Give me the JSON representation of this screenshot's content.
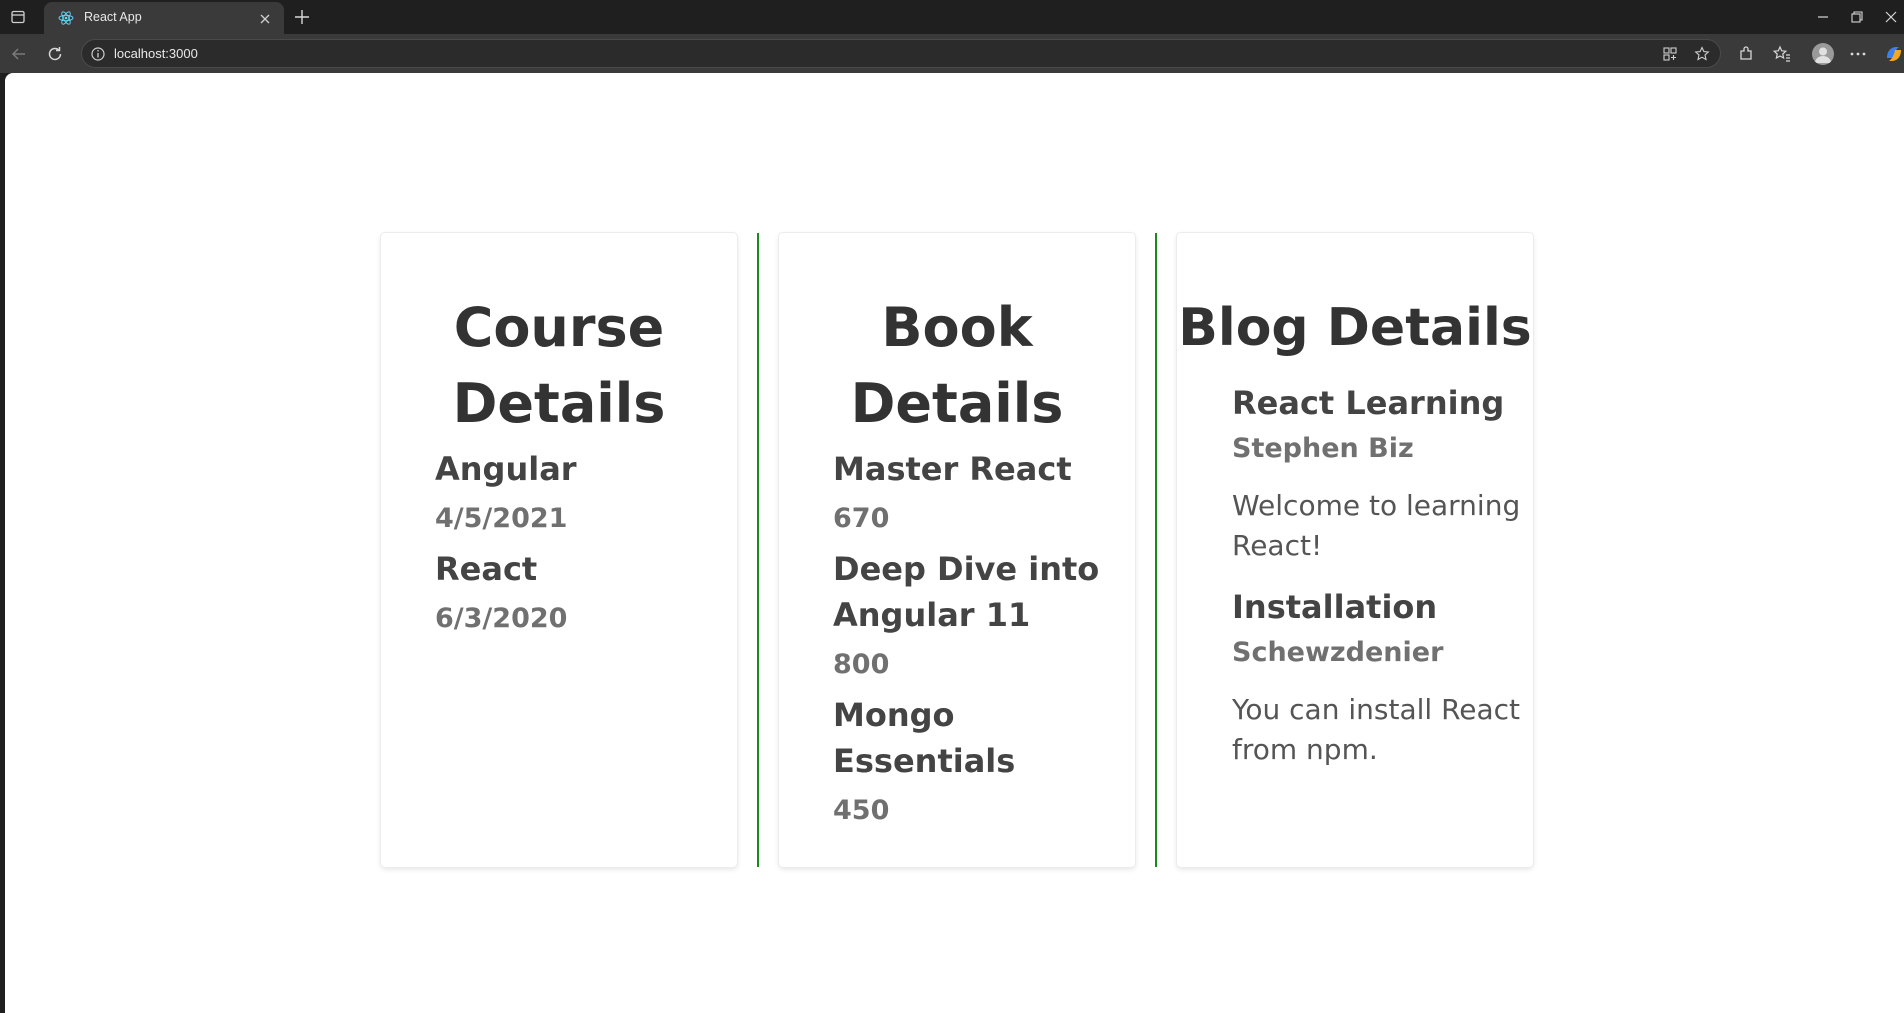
{
  "browser": {
    "tab_title": "React App",
    "url": "localhost:3000"
  },
  "course": {
    "title": "Course Details",
    "items": [
      {
        "name": "Angular",
        "date": "4/5/2021"
      },
      {
        "name": "React",
        "date": "6/3/2020"
      }
    ]
  },
  "book": {
    "title": "Book Details",
    "items": [
      {
        "name": "Master React",
        "price": "670"
      },
      {
        "name": "Deep Dive into Angular 11",
        "price": "800"
      },
      {
        "name": "Mongo Essentials",
        "price": "450"
      }
    ]
  },
  "blog": {
    "title": "Blog Details",
    "items": [
      {
        "title": "React Learning",
        "author": "Stephen Biz",
        "body": "Welcome to learning React!"
      },
      {
        "title": "Installation",
        "author": "Schewzdenier",
        "body": "You can install React from npm."
      }
    ]
  },
  "colors": {
    "divider": "#1a8a1a",
    "heading": "#333333",
    "subtext": "#707070"
  }
}
